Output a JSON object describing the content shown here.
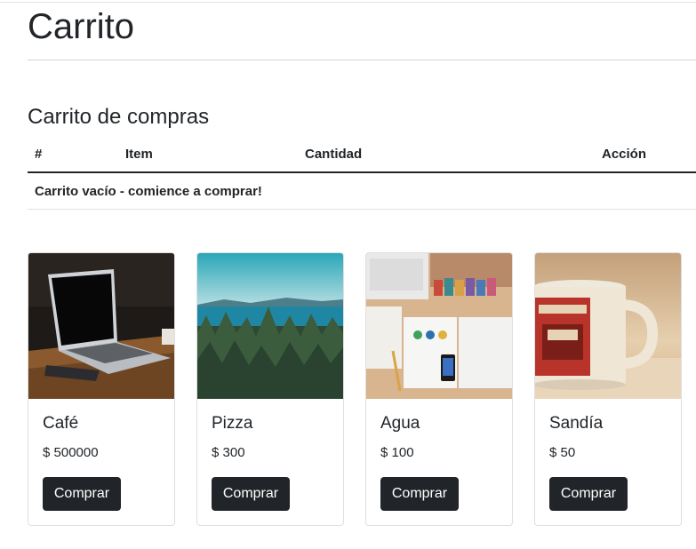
{
  "page": {
    "title": "Carrito"
  },
  "cart": {
    "heading": "Carrito de compras",
    "columns": [
      "#",
      "Item",
      "Cantidad",
      "Acción"
    ],
    "empty_message": "Carrito vacío - comience a comprar!"
  },
  "products": [
    {
      "name": "Café",
      "price": "$ 500000",
      "button": "Comprar",
      "image": "laptop-on-desk"
    },
    {
      "name": "Pizza",
      "price": "$ 300",
      "button": "Comprar",
      "image": "forest-and-sea"
    },
    {
      "name": "Agua",
      "price": "$ 100",
      "button": "Comprar",
      "image": "desk-flatlay"
    },
    {
      "name": "Sandía",
      "price": "$ 50",
      "button": "Comprar",
      "image": "red-mug"
    }
  ],
  "colors": {
    "button": "#212529",
    "text": "#212529",
    "border": "#dfdfdf"
  }
}
